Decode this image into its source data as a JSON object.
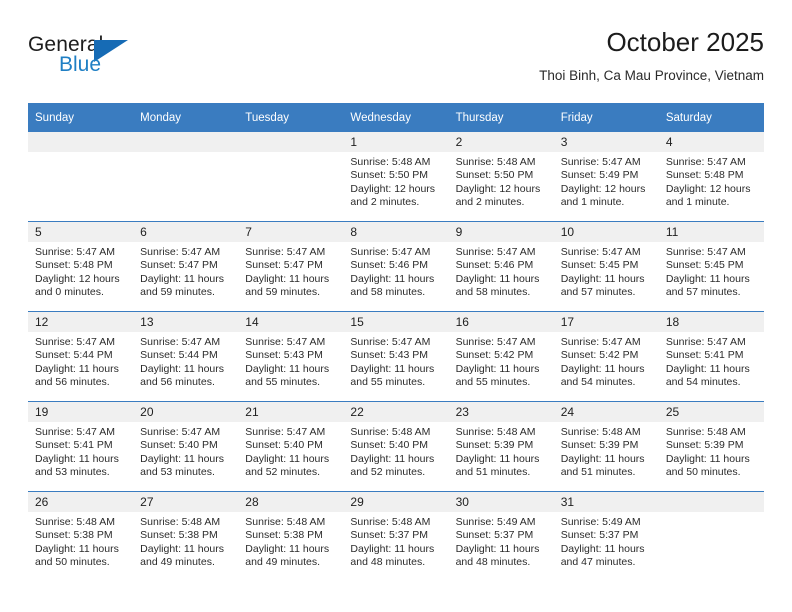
{
  "logo": {
    "word1": "General",
    "word2": "Blue",
    "triangle_color": "#166bb5",
    "blue_text_color": "#1f7fc4",
    "icon": "triangle-icon"
  },
  "header": {
    "month_title": "October 2025",
    "location": "Thoi Binh, Ca Mau Province, Vietnam"
  },
  "calendar": {
    "header_bg": "#3a7cc0",
    "daynum_bg": "#f0f0f0",
    "labels": {
      "sunrise": "Sunrise:",
      "sunset": "Sunset:",
      "daylight": "Daylight:"
    },
    "weekdays": [
      "Sunday",
      "Monday",
      "Tuesday",
      "Wednesday",
      "Thursday",
      "Friday",
      "Saturday"
    ],
    "weeks": [
      [
        {
          "day": "",
          "sunrise": "",
          "sunset": "",
          "daylight": ""
        },
        {
          "day": "",
          "sunrise": "",
          "sunset": "",
          "daylight": ""
        },
        {
          "day": "",
          "sunrise": "",
          "sunset": "",
          "daylight": ""
        },
        {
          "day": "1",
          "sunrise": "Sunrise: 5:48 AM",
          "sunset": "Sunset: 5:50 PM",
          "daylight": "Daylight: 12 hours and 2 minutes."
        },
        {
          "day": "2",
          "sunrise": "Sunrise: 5:48 AM",
          "sunset": "Sunset: 5:50 PM",
          "daylight": "Daylight: 12 hours and 2 minutes."
        },
        {
          "day": "3",
          "sunrise": "Sunrise: 5:47 AM",
          "sunset": "Sunset: 5:49 PM",
          "daylight": "Daylight: 12 hours and 1 minute."
        },
        {
          "day": "4",
          "sunrise": "Sunrise: 5:47 AM",
          "sunset": "Sunset: 5:48 PM",
          "daylight": "Daylight: 12 hours and 1 minute."
        }
      ],
      [
        {
          "day": "5",
          "sunrise": "Sunrise: 5:47 AM",
          "sunset": "Sunset: 5:48 PM",
          "daylight": "Daylight: 12 hours and 0 minutes."
        },
        {
          "day": "6",
          "sunrise": "Sunrise: 5:47 AM",
          "sunset": "Sunset: 5:47 PM",
          "daylight": "Daylight: 11 hours and 59 minutes."
        },
        {
          "day": "7",
          "sunrise": "Sunrise: 5:47 AM",
          "sunset": "Sunset: 5:47 PM",
          "daylight": "Daylight: 11 hours and 59 minutes."
        },
        {
          "day": "8",
          "sunrise": "Sunrise: 5:47 AM",
          "sunset": "Sunset: 5:46 PM",
          "daylight": "Daylight: 11 hours and 58 minutes."
        },
        {
          "day": "9",
          "sunrise": "Sunrise: 5:47 AM",
          "sunset": "Sunset: 5:46 PM",
          "daylight": "Daylight: 11 hours and 58 minutes."
        },
        {
          "day": "10",
          "sunrise": "Sunrise: 5:47 AM",
          "sunset": "Sunset: 5:45 PM",
          "daylight": "Daylight: 11 hours and 57 minutes."
        },
        {
          "day": "11",
          "sunrise": "Sunrise: 5:47 AM",
          "sunset": "Sunset: 5:45 PM",
          "daylight": "Daylight: 11 hours and 57 minutes."
        }
      ],
      [
        {
          "day": "12",
          "sunrise": "Sunrise: 5:47 AM",
          "sunset": "Sunset: 5:44 PM",
          "daylight": "Daylight: 11 hours and 56 minutes."
        },
        {
          "day": "13",
          "sunrise": "Sunrise: 5:47 AM",
          "sunset": "Sunset: 5:44 PM",
          "daylight": "Daylight: 11 hours and 56 minutes."
        },
        {
          "day": "14",
          "sunrise": "Sunrise: 5:47 AM",
          "sunset": "Sunset: 5:43 PM",
          "daylight": "Daylight: 11 hours and 55 minutes."
        },
        {
          "day": "15",
          "sunrise": "Sunrise: 5:47 AM",
          "sunset": "Sunset: 5:43 PM",
          "daylight": "Daylight: 11 hours and 55 minutes."
        },
        {
          "day": "16",
          "sunrise": "Sunrise: 5:47 AM",
          "sunset": "Sunset: 5:42 PM",
          "daylight": "Daylight: 11 hours and 55 minutes."
        },
        {
          "day": "17",
          "sunrise": "Sunrise: 5:47 AM",
          "sunset": "Sunset: 5:42 PM",
          "daylight": "Daylight: 11 hours and 54 minutes."
        },
        {
          "day": "18",
          "sunrise": "Sunrise: 5:47 AM",
          "sunset": "Sunset: 5:41 PM",
          "daylight": "Daylight: 11 hours and 54 minutes."
        }
      ],
      [
        {
          "day": "19",
          "sunrise": "Sunrise: 5:47 AM",
          "sunset": "Sunset: 5:41 PM",
          "daylight": "Daylight: 11 hours and 53 minutes."
        },
        {
          "day": "20",
          "sunrise": "Sunrise: 5:47 AM",
          "sunset": "Sunset: 5:40 PM",
          "daylight": "Daylight: 11 hours and 53 minutes."
        },
        {
          "day": "21",
          "sunrise": "Sunrise: 5:47 AM",
          "sunset": "Sunset: 5:40 PM",
          "daylight": "Daylight: 11 hours and 52 minutes."
        },
        {
          "day": "22",
          "sunrise": "Sunrise: 5:48 AM",
          "sunset": "Sunset: 5:40 PM",
          "daylight": "Daylight: 11 hours and 52 minutes."
        },
        {
          "day": "23",
          "sunrise": "Sunrise: 5:48 AM",
          "sunset": "Sunset: 5:39 PM",
          "daylight": "Daylight: 11 hours and 51 minutes."
        },
        {
          "day": "24",
          "sunrise": "Sunrise: 5:48 AM",
          "sunset": "Sunset: 5:39 PM",
          "daylight": "Daylight: 11 hours and 51 minutes."
        },
        {
          "day": "25",
          "sunrise": "Sunrise: 5:48 AM",
          "sunset": "Sunset: 5:39 PM",
          "daylight": "Daylight: 11 hours and 50 minutes."
        }
      ],
      [
        {
          "day": "26",
          "sunrise": "Sunrise: 5:48 AM",
          "sunset": "Sunset: 5:38 PM",
          "daylight": "Daylight: 11 hours and 50 minutes."
        },
        {
          "day": "27",
          "sunrise": "Sunrise: 5:48 AM",
          "sunset": "Sunset: 5:38 PM",
          "daylight": "Daylight: 11 hours and 49 minutes."
        },
        {
          "day": "28",
          "sunrise": "Sunrise: 5:48 AM",
          "sunset": "Sunset: 5:38 PM",
          "daylight": "Daylight: 11 hours and 49 minutes."
        },
        {
          "day": "29",
          "sunrise": "Sunrise: 5:48 AM",
          "sunset": "Sunset: 5:37 PM",
          "daylight": "Daylight: 11 hours and 48 minutes."
        },
        {
          "day": "30",
          "sunrise": "Sunrise: 5:49 AM",
          "sunset": "Sunset: 5:37 PM",
          "daylight": "Daylight: 11 hours and 48 minutes."
        },
        {
          "day": "31",
          "sunrise": "Sunrise: 5:49 AM",
          "sunset": "Sunset: 5:37 PM",
          "daylight": "Daylight: 11 hours and 47 minutes."
        },
        {
          "day": "",
          "sunrise": "",
          "sunset": "",
          "daylight": ""
        }
      ]
    ]
  }
}
